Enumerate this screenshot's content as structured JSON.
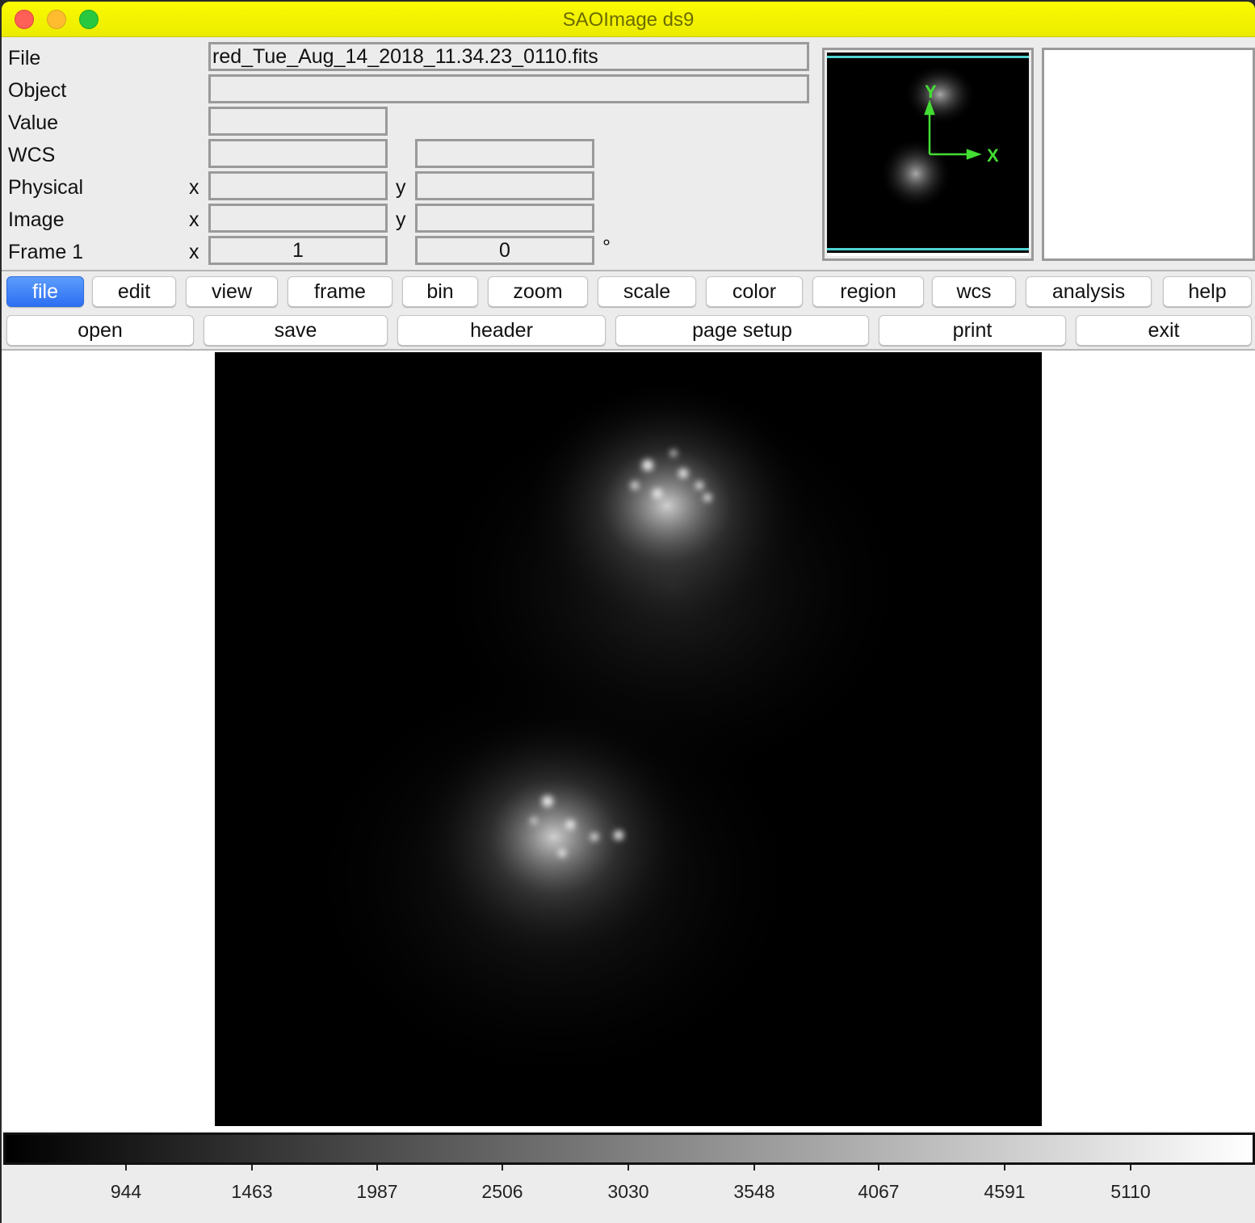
{
  "window": {
    "title": "SAOImage ds9",
    "controls": [
      "close",
      "minimize",
      "maximize"
    ]
  },
  "info_panel": {
    "file_label": "File",
    "file_value": "red_Tue_Aug_14_2018_11.34.23_0110.fits",
    "object_label": "Object",
    "object_value": "",
    "value_label": "Value",
    "value_value": "",
    "wcs_label": "WCS",
    "wcs_value_1": "",
    "wcs_value_2": "",
    "physical_label": "Physical",
    "physical_x_label": "x",
    "physical_x": "",
    "physical_y_label": "y",
    "physical_y": "",
    "image_label": "Image",
    "image_x_label": "x",
    "image_x": "",
    "image_y_label": "y",
    "image_y": "",
    "frame_label": "Frame 1",
    "frame_x_label": "x",
    "frame_zoom": "1",
    "frame_angle": "0",
    "angle_unit": "°"
  },
  "panner": {
    "compass_x_label": "X",
    "compass_y_label": "Y",
    "compass_color": "#44dd33",
    "bbox_color": "#4fd3d3"
  },
  "menu_bar": {
    "items": [
      {
        "label": "file",
        "active": true
      },
      {
        "label": "edit",
        "active": false
      },
      {
        "label": "view",
        "active": false
      },
      {
        "label": "frame",
        "active": false
      },
      {
        "label": "bin",
        "active": false
      },
      {
        "label": "zoom",
        "active": false
      },
      {
        "label": "scale",
        "active": false
      },
      {
        "label": "color",
        "active": false
      },
      {
        "label": "region",
        "active": false
      },
      {
        "label": "wcs",
        "active": false
      },
      {
        "label": "analysis",
        "active": false
      },
      {
        "label": "help",
        "active": false
      }
    ]
  },
  "button_bar": {
    "items": [
      {
        "label": "open"
      },
      {
        "label": "save"
      },
      {
        "label": "header"
      },
      {
        "label": "page setup"
      },
      {
        "label": "print"
      },
      {
        "label": "exit"
      }
    ]
  },
  "colorbar": {
    "colormap": "grey",
    "ticks": [
      "944",
      "1463",
      "1987",
      "2506",
      "3030",
      "3548",
      "4067",
      "4591",
      "5110"
    ]
  }
}
